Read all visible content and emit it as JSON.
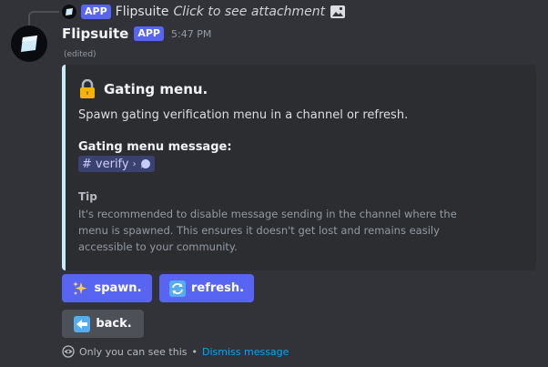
{
  "reply": {
    "app_badge": "APP",
    "name": "Flipsuite",
    "text": "Click to see attachment",
    "attachment_icon": "image-icon"
  },
  "message": {
    "username": "Flipsuite",
    "app_badge": "APP",
    "timestamp": "5:47 PM",
    "edited": "(edited)"
  },
  "embed": {
    "accent_color": "#c7ebf7",
    "title_icon": "lock-icon",
    "title": "Gating menu.",
    "description": "Spawn gating verification menu in a channel or refresh.",
    "field1_name": "Gating menu message:",
    "channel": {
      "hash": "#",
      "name": "verify",
      "chevron": "›",
      "icon": "speech-bubble-icon"
    },
    "tip_name": "Tip",
    "tip_text": "It's recommended to disable message sending in the channel where the menu is spawned. This ensures it doesn't get lost and remains easily accessible to your community."
  },
  "buttons": {
    "spawn_label": "spawn.",
    "spawn_icon": "sparkles-icon",
    "refresh_label": "refresh.",
    "refresh_icon": "refresh-icon",
    "back_label": "back.",
    "back_icon": "left-arrow-icon"
  },
  "ephemeral": {
    "notice": "Only you can see this",
    "separator": "•",
    "dismiss": "Dismiss message"
  },
  "colors": {
    "background": "#323339",
    "blurple": "#5865f2",
    "secondary": "#4e5058",
    "link": "#00a8fc"
  }
}
